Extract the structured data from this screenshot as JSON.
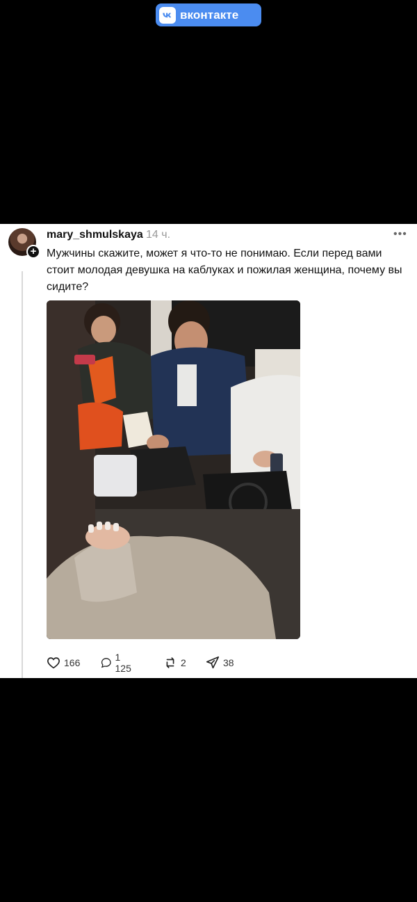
{
  "badge": {
    "brand": "вконтакте",
    "icon": "vk-logo-icon",
    "color": "#4b8cf0"
  },
  "post": {
    "username": "mary_shmulskaya",
    "time": "14 ч.",
    "more": "•••",
    "text": "Мужчины скажите, может я что-то не понимаю. Если перед вами стоит молодая девушка на каблуках и пожилая женщина, почему вы сидите?",
    "stats": {
      "likes": "166",
      "comments": "1 125",
      "reposts": "2",
      "shares": "38"
    }
  }
}
